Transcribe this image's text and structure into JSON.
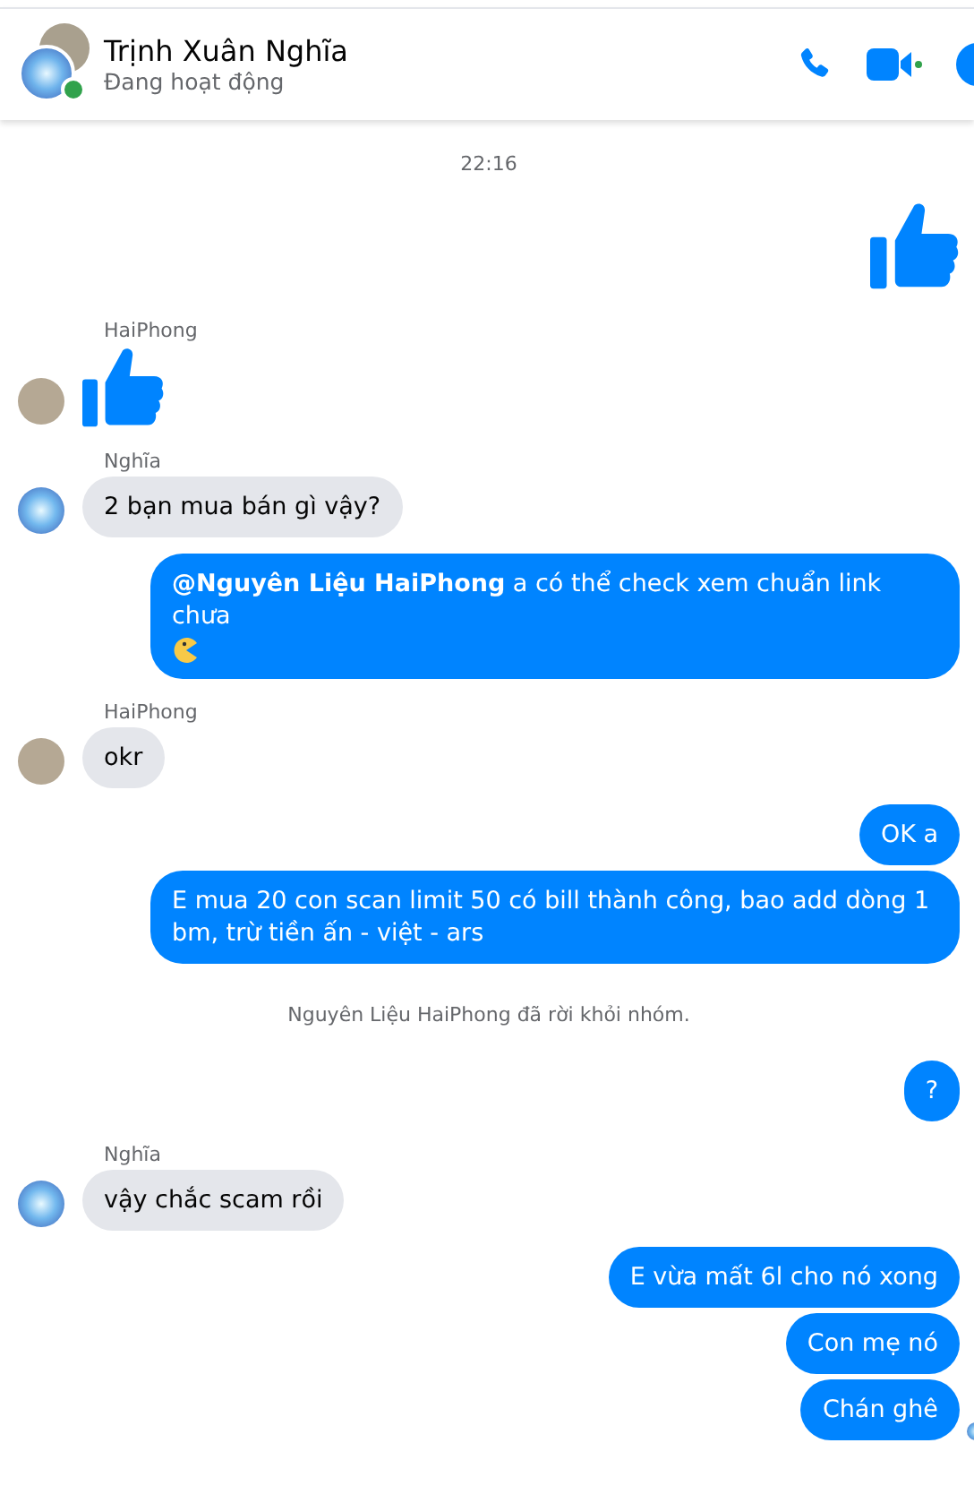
{
  "header": {
    "name": "Trịnh Xuân Nghĩa",
    "status": "Đang hoạt động",
    "online": true
  },
  "messages": [
    {
      "kind": "timestamp",
      "text": "22:16"
    },
    {
      "kind": "like_out"
    },
    {
      "kind": "like_in",
      "sender": "HaiPhong",
      "avatar": {
        "kind": "photo"
      }
    },
    {
      "kind": "incoming",
      "sender": "Nghĩa",
      "avatar": {
        "kind": "orb"
      },
      "text": "2 bạn mua bán gì vậy?"
    },
    {
      "kind": "outgoing",
      "text": "**@Nguyên Liệu HaiPhong** a có thể check xem chuẩn link chưa",
      "trailing_icon": {
        "kind": "pacman"
      }
    },
    {
      "kind": "incoming",
      "sender": "HaiPhong",
      "avatar": {
        "kind": "photo"
      },
      "text": "okr"
    },
    {
      "kind": "outgoing",
      "text": "OK a"
    },
    {
      "kind": "outgoing",
      "text": "E mua 20 con scan limit 50 có bill thành công, bao add dòng 1 bm, trừ tiền ấn - việt - ars"
    },
    {
      "kind": "system",
      "text": "Nguyên Liệu HaiPhong đã rời khỏi nhóm."
    },
    {
      "kind": "outgoing",
      "text": "?"
    },
    {
      "kind": "incoming",
      "sender": "Nghĩa",
      "avatar": {
        "kind": "orb"
      },
      "text": "vậy chắc scam rồi"
    },
    {
      "kind": "outgoing",
      "text": "E vừa mất 6l cho nó xong"
    },
    {
      "kind": "outgoing",
      "text": "Con mẹ nó"
    },
    {
      "kind": "outgoing",
      "text": "Chán ghê",
      "seen": true
    }
  ]
}
